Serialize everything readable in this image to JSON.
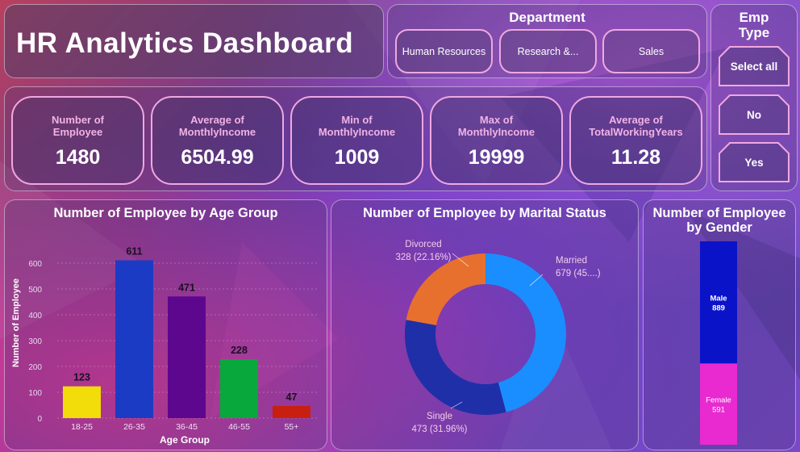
{
  "header": {
    "title": "HR Analytics Dashboard"
  },
  "department": {
    "label": "Department",
    "options": [
      "Human Resources",
      "Research &...",
      "Sales"
    ]
  },
  "emp_type": {
    "label_line1": "Emp",
    "label_line2": "Type",
    "options": [
      "Select all",
      "No",
      "Yes"
    ]
  },
  "kpis": [
    {
      "label_line1": "Number of",
      "label_line2": "Employee",
      "value": "1480"
    },
    {
      "label_line1": "Average of",
      "label_line2": "MonthlyIncome",
      "value": "6504.99"
    },
    {
      "label_line1": "Min of",
      "label_line2": "MonthlyIncome",
      "value": "1009"
    },
    {
      "label_line1": "Max of",
      "label_line2": "MonthlyIncome",
      "value": "19999"
    },
    {
      "label_line1": "Average of",
      "label_line2": "TotalWorkingYears",
      "value": "11.28"
    }
  ],
  "colors": {
    "accent_border": "#f0a8e0",
    "kpi_label": "#f2b2e4"
  },
  "chart_data": [
    {
      "type": "bar",
      "title": "Number of Employee by Age Group",
      "xlabel": "Age Group",
      "ylabel": "Number of Employee",
      "categories": [
        "18-25",
        "26-35",
        "36-45",
        "46-55",
        "55+"
      ],
      "values": [
        123,
        611,
        471,
        228,
        47
      ],
      "colors": [
        "#f2dc0a",
        "#1c3bc4",
        "#5d078f",
        "#09a83c",
        "#c91f10"
      ],
      "ylim": [
        0,
        650
      ],
      "yticks": [
        0,
        100,
        200,
        300,
        400,
        500,
        600
      ],
      "grid": true
    },
    {
      "type": "pie",
      "title": "Number of Employee by Marital Status",
      "categories": [
        "Married",
        "Single",
        "Divorced"
      ],
      "values": [
        679,
        473,
        328
      ],
      "labels": [
        "679 (45....)",
        "473 (31.96%)",
        "328 (22.16%)"
      ],
      "colors": [
        "#1a8dff",
        "#1f2fa8",
        "#e8702e"
      ]
    },
    {
      "type": "bar",
      "title_line1": "Number of Employee",
      "title_line2": "by Gender",
      "categories": [
        "Male",
        "Female"
      ],
      "values": [
        889,
        591
      ],
      "colors": [
        "#0b13c9",
        "#e82ad0"
      ]
    }
  ]
}
